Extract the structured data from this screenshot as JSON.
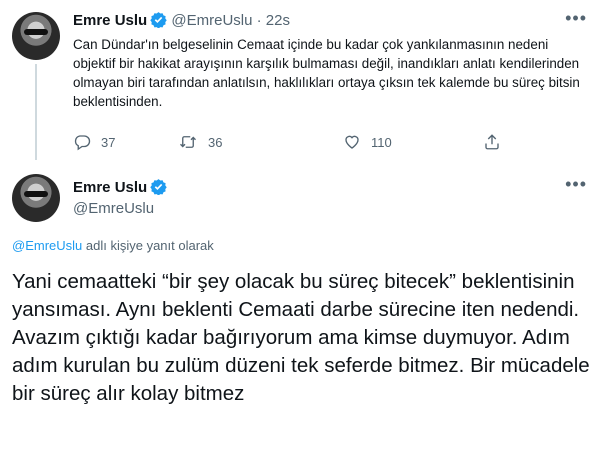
{
  "tweet1": {
    "name": "Emre Uslu",
    "handle": "@EmreUslu",
    "separator": "·",
    "time": "22s",
    "text": "Can Dündar'ın belgeselinin Cemaat içinde bu kadar çok yankılanmasının nedeni objektif bir hakikat arayışının karşılık bulmaması değil, inandıkları anlatı kendilerinden olmayan biri tarafından anlatılsın, haklılıkları ortaya çıksın tek kalemde bu süreç bitsin beklentisinden.",
    "actions": {
      "reply_count": "37",
      "retweet_count": "36",
      "like_count": "110"
    }
  },
  "tweet2": {
    "name": "Emre Uslu",
    "handle": "@EmreUslu",
    "replying_mention": "@EmreUslu",
    "replying_text": " adlı kişiye yanıt olarak",
    "text": "Yani cemaatteki “bir şey olacak bu süreç bitecek” beklentisinin yansıması. Aynı beklenti Cemaati darbe sürecine iten nedendi. Avazım çıktığı kadar bağırıyorum ama kimse duymuyor. Adım adım kurulan bu zulüm düzeni tek seferde bitmez. Bir mücadele bir süreç alır kolay bitmez"
  },
  "icons": {
    "verified": "verified-badge-icon",
    "more": "more-dots-icon",
    "reply": "reply-icon",
    "retweet": "retweet-icon",
    "like": "heart-icon",
    "share": "share-icon"
  },
  "colors": {
    "accent": "#1d9bf0",
    "secondary_text": "#536471",
    "primary_text": "#0f1419"
  }
}
